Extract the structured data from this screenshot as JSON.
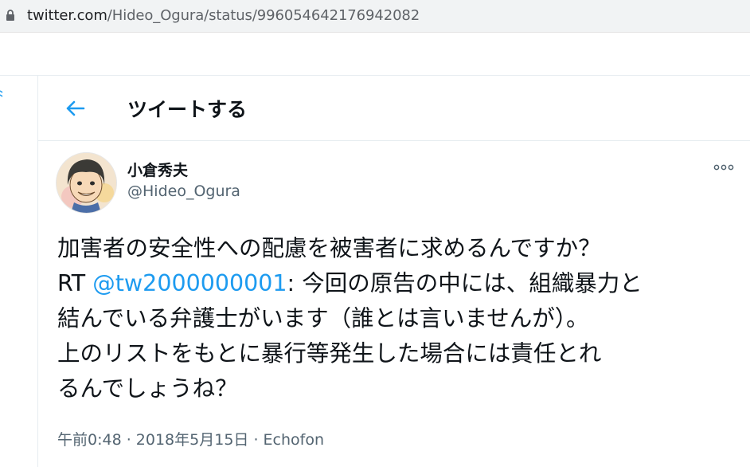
{
  "browser": {
    "url_domain": "twitter.com",
    "url_path": "/Hideo_Ogura/status/996054642176942082"
  },
  "header": {
    "title": "ツイートする"
  },
  "tweet": {
    "author_name": "小倉秀夫",
    "author_handle": "@Hideo_Ogura",
    "lines": [
      "加害者の安全性への配慮を被害者に求めるんですか？",
      "今回の原告の中には、組織暴力と",
      "結んでいる弁護士がいます（誰とは言いませんが）。",
      "上のリストをもとに暴行等発生した場合には責任とれ",
      "るんでしょうね？"
    ],
    "rt_prefix": "RT ",
    "mention": "@tw2000000001",
    "mention_suffix": ": ",
    "time": "午前0:48",
    "date": "2018年5月15日",
    "source": "Echofon",
    "meta_sep": " · "
  },
  "colors": {
    "accent": "#1d9bf0",
    "text": "#0f1419",
    "secondary": "#536471"
  },
  "icons": {
    "lock": "lock-icon",
    "back": "back-arrow-icon",
    "more": "more-options-icon"
  }
}
